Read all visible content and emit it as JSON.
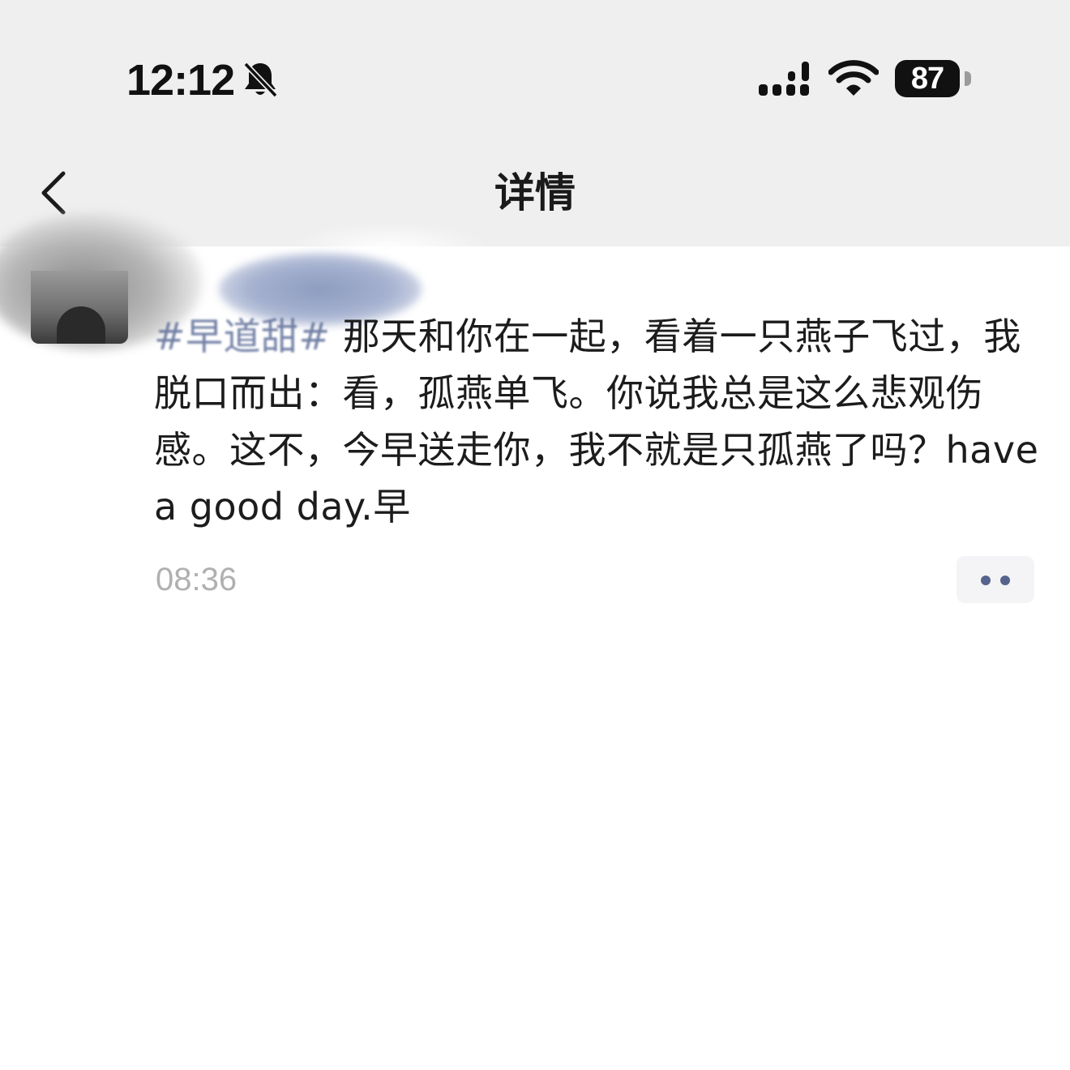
{
  "status_bar": {
    "time": "12:12",
    "battery_level": "87",
    "icons": [
      "bell-slash-icon",
      "cellular-signal-icon",
      "wifi-icon",
      "battery-icon"
    ]
  },
  "nav": {
    "title": "详情",
    "back_icon": "chevron-left-icon"
  },
  "post": {
    "hashtag": "#早道甜#",
    "text": " 那天和你在一起，看着一只燕子飞过，我脱口而出：看，孤燕单飞。你说我总是这么悲观伤感。这不，今早送走你，我不就是只孤燕了吗？have a good day.早",
    "time": "08:36",
    "more_icon": "more-dots-icon"
  },
  "colors": {
    "topbar_bg": "#efefef",
    "hashtag": "#5b6b96",
    "time_gray": "#b0b0b0",
    "dots": "#55648c"
  }
}
